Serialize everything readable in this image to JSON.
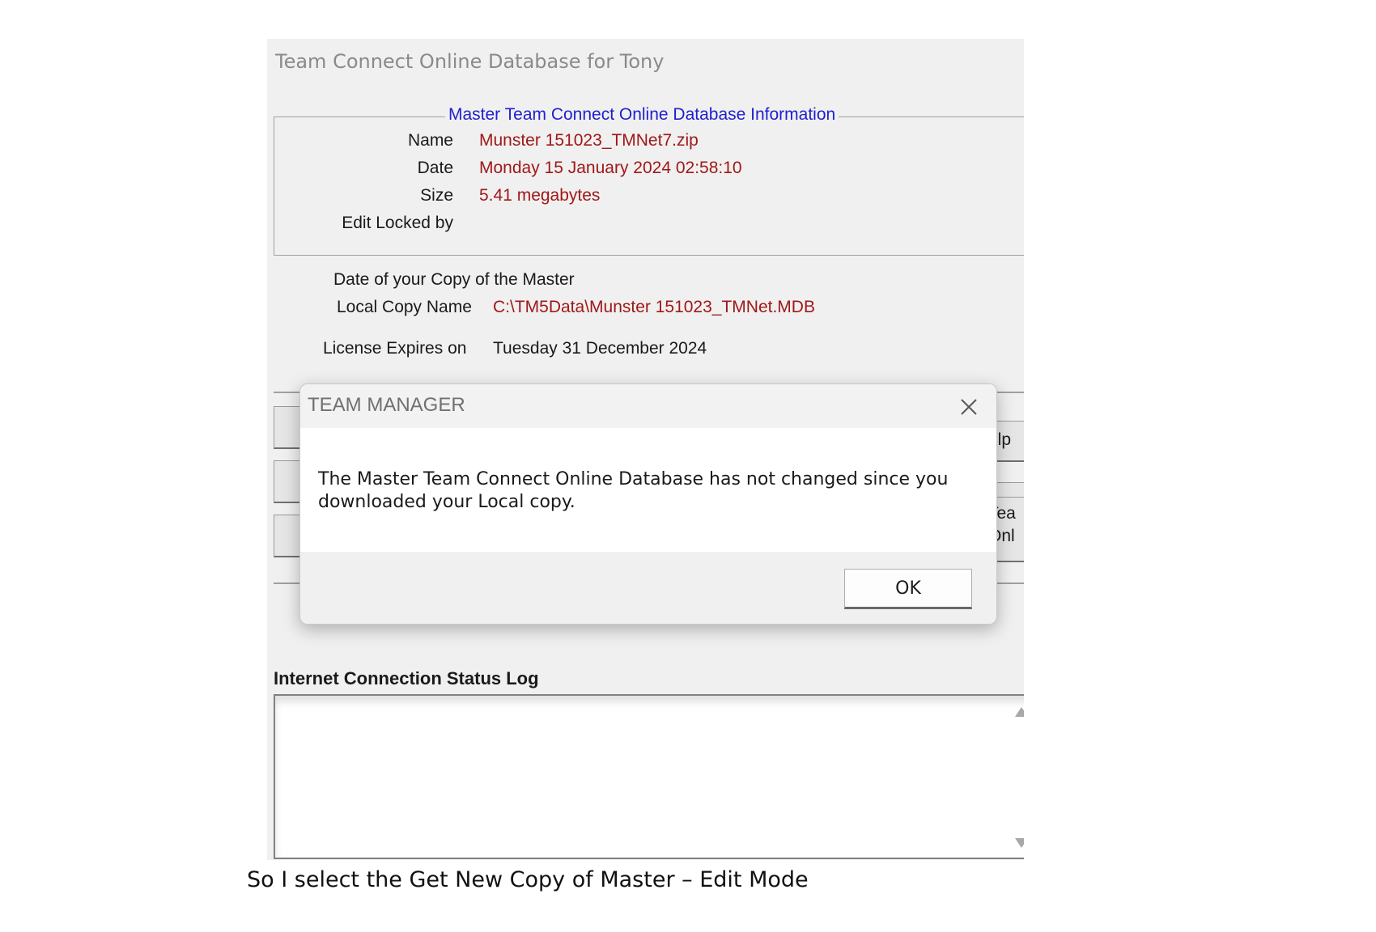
{
  "window": {
    "title": "Team Connect Online Database for Tony"
  },
  "master_info": {
    "legend": "Master Team Connect Online Database Information",
    "name_label": "Name",
    "name_value": "Munster 151023_TMNet7.zip",
    "date_label": "Date",
    "date_value": "Monday 15 January 2024 02:58:10",
    "size_label": "Size",
    "size_value": "5.41 megabytes",
    "locked_label": "Edit Locked by"
  },
  "local_copy": {
    "date_label": "Date of your Copy of the  Master",
    "name_label": "Local Copy Name",
    "name_value": "C:\\TM5Data\\Munster 151023_TMNet.MDB"
  },
  "license": {
    "label": "License Expires on",
    "value": "Tuesday 31 December 2024"
  },
  "partial_buttons": {
    "help": "elp",
    "team_line1": "Tea",
    "team_line2": "Onl"
  },
  "log": {
    "title": "Internet Connection Status Log"
  },
  "dialog": {
    "title": "TEAM MANAGER",
    "message": "The Master Team Connect Online Database has not changed since you downloaded your Local copy.",
    "ok_label": "OK"
  },
  "caption": "So I select the Get New Copy of Master – Edit Mode"
}
